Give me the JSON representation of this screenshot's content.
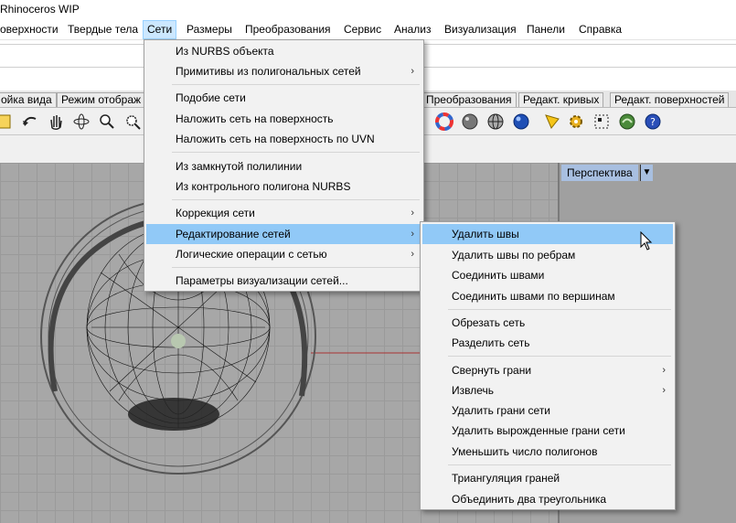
{
  "window": {
    "title": "Rhinoceros WIP"
  },
  "menubar": {
    "items": [
      {
        "label": "оверхности"
      },
      {
        "label": "Твердые тела"
      },
      {
        "label": "Сети"
      },
      {
        "label": "Размеры"
      },
      {
        "label": "Преобразования"
      },
      {
        "label": "Сервис"
      },
      {
        "label": "Анализ"
      },
      {
        "label": "Визуализация"
      },
      {
        "label": "Панели"
      },
      {
        "label": "Справка"
      }
    ]
  },
  "tabs": {
    "items": [
      {
        "label": "ойка вида"
      },
      {
        "label": "Режим отображ"
      },
      {
        "label": "Преобразования"
      },
      {
        "label": "Редакт. кривых"
      },
      {
        "label": "Редакт. поверхностей"
      }
    ]
  },
  "toolbar": {
    "icons": [
      "select-icon",
      "rotate-arrow-icon",
      "pan-hand-icon",
      "orbit-icon",
      "zoom-icon",
      "zoom-window-icon",
      "color-wheel-icon",
      "shaded-sphere-icon",
      "wireframe-sphere-icon",
      "rendered-sphere-icon",
      "light-icon",
      "settings-gear-icon",
      "grouping-icon",
      "python-icon",
      "help-icon"
    ]
  },
  "viewport": {
    "label": "Перспектива",
    "accent": "#a8bfe0"
  },
  "mesh_menu": {
    "items": [
      {
        "label": "Из NURBS объекта",
        "submenu": false
      },
      {
        "label": "Примитивы из полигональных сетей",
        "submenu": true
      },
      {
        "label": "Подобие сети",
        "submenu": false
      },
      {
        "label": "Наложить сеть на поверхность",
        "submenu": false
      },
      {
        "label": "Наложить сеть на поверхность по UVN",
        "submenu": false
      },
      {
        "label": "Из замкнутой полилинии",
        "submenu": false
      },
      {
        "label": "Из контрольного полигона NURBS",
        "submenu": false
      },
      {
        "label": "Коррекция сети",
        "submenu": true
      },
      {
        "label": "Редактирование сетей",
        "submenu": true
      },
      {
        "label": "Логические операции с сетью",
        "submenu": true
      },
      {
        "label": "Параметры визуализации сетей...",
        "submenu": false
      }
    ]
  },
  "edit_submenu": {
    "items": [
      {
        "label": "Удалить швы",
        "submenu": false
      },
      {
        "label": "Удалить швы по ребрам",
        "submenu": false
      },
      {
        "label": "Соединить швами",
        "submenu": false
      },
      {
        "label": "Соединить швами по вершинам",
        "submenu": false
      },
      {
        "label": "Обрезать сеть",
        "submenu": false
      },
      {
        "label": "Разделить сеть",
        "submenu": false
      },
      {
        "label": "Свернуть грани",
        "submenu": true
      },
      {
        "label": "Извлечь",
        "submenu": true
      },
      {
        "label": "Удалить грани сети",
        "submenu": false
      },
      {
        "label": "Удалить вырожденные грани сети",
        "submenu": false
      },
      {
        "label": "Уменьшить число полигонов",
        "submenu": false
      },
      {
        "label": "Триангуляция граней",
        "submenu": false
      },
      {
        "label": "Объединить два треугольника",
        "submenu": false
      }
    ]
  },
  "colors": {
    "highlight": "#91c9f7",
    "menubar_active": "#cce8ff"
  }
}
